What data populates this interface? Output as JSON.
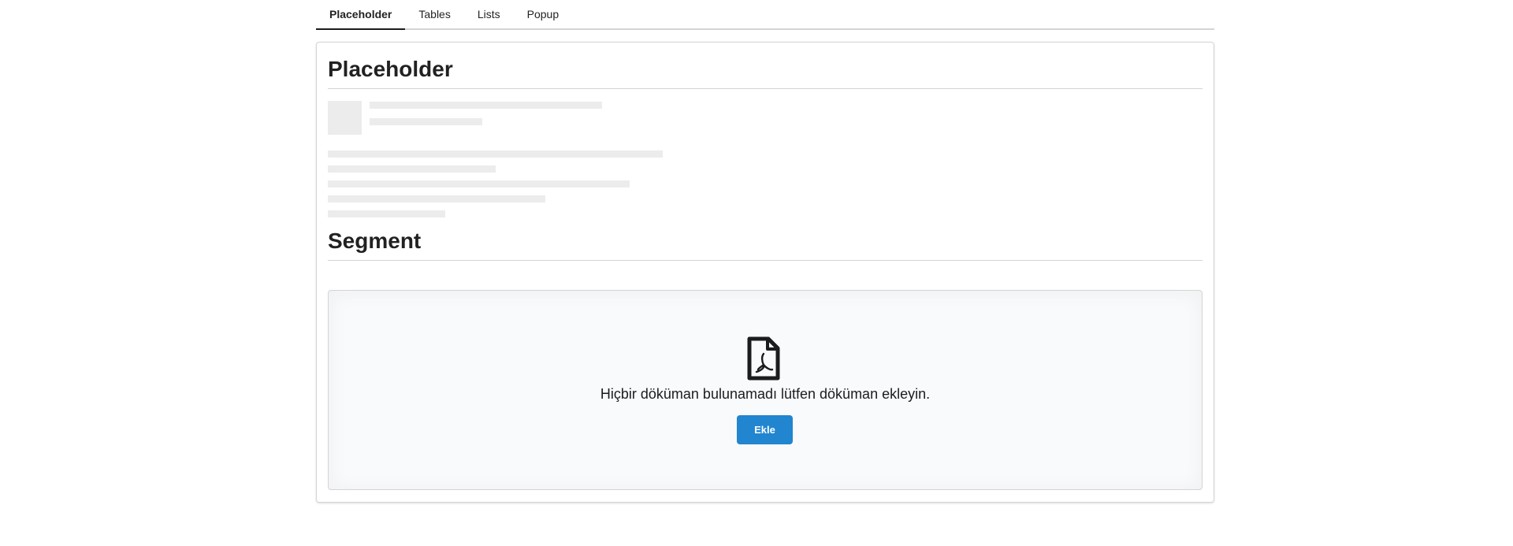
{
  "tabs": [
    {
      "label": "Placeholder",
      "active": true
    },
    {
      "label": "Tables",
      "active": false
    },
    {
      "label": "Lists",
      "active": false
    },
    {
      "label": "Popup",
      "active": false
    }
  ],
  "placeholder_section": {
    "title": "Placeholder"
  },
  "segment_section": {
    "title": "Segment",
    "icon": "file-pdf-icon",
    "message": "Hiçbir döküman bulunamadı lütfen döküman ekleyin.",
    "button_label": "Ekle"
  },
  "colors": {
    "primary_button": "#2185d0",
    "placeholder_bar": "#ececec",
    "segment_background": "#f9fafb",
    "border": "#d4d4d5"
  }
}
